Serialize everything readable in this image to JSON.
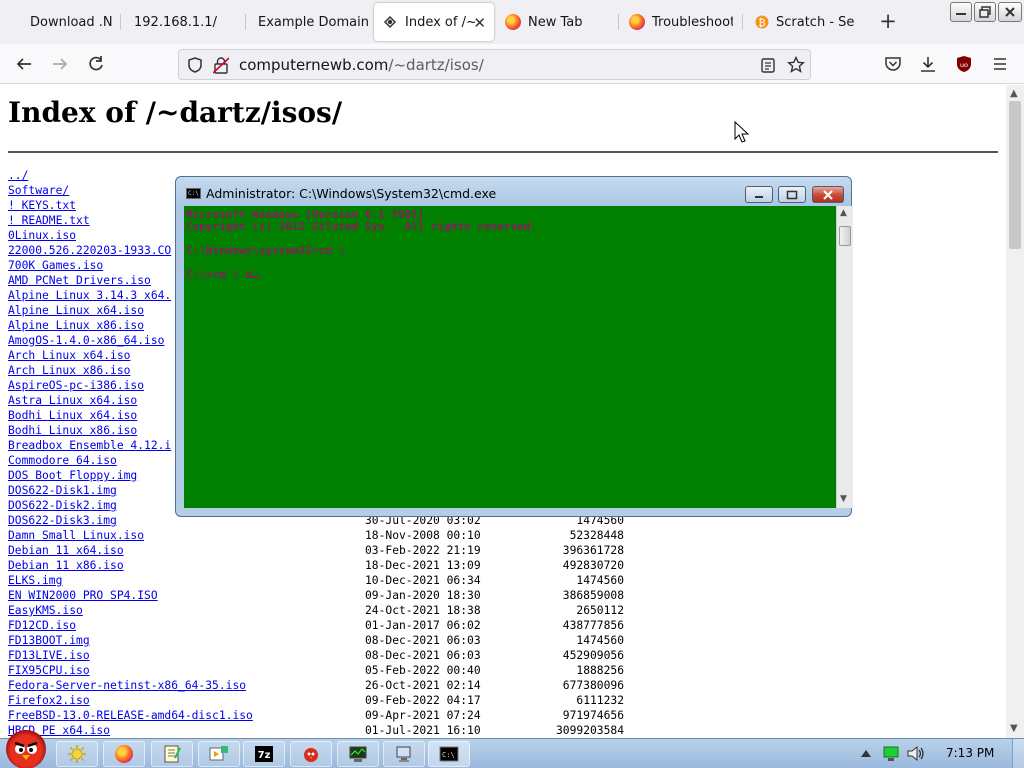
{
  "browser": {
    "tabs": [
      {
        "title": "Download .NE",
        "icon": "dotnet-icon",
        "active": false
      },
      {
        "title": "192.168.1.1/",
        "icon": "none",
        "active": false
      },
      {
        "title": "Example Domain",
        "icon": "none",
        "active": false
      },
      {
        "title": "Index of /~",
        "icon": "server-icon",
        "active": true
      },
      {
        "title": "New Tab",
        "icon": "firefox-icon",
        "active": false
      },
      {
        "title": "Troubleshooti",
        "icon": "firefox-icon",
        "active": false
      },
      {
        "title": "Scratch - Sear",
        "icon": "bitcoin-icon",
        "active": false
      }
    ],
    "url": {
      "host": "computernewb.com",
      "path": "/~dartz/isos/"
    }
  },
  "page": {
    "title": "Index of /~dartz/isos/",
    "files": [
      {
        "name": "../",
        "date": "",
        "size": ""
      },
      {
        "name": "Software/",
        "date": "",
        "size": ""
      },
      {
        "name": "! KEYS.txt",
        "date": "",
        "size": ""
      },
      {
        "name": "! README.txt",
        "date": "",
        "size": ""
      },
      {
        "name": "0Linux.iso",
        "date": "",
        "size": ""
      },
      {
        "name": "22000.526.220203-1933.CO",
        "date": "",
        "size": ""
      },
      {
        "name": "700K Games.iso",
        "date": "",
        "size": ""
      },
      {
        "name": "AMD PCNet Drivers.iso",
        "date": "",
        "size": ""
      },
      {
        "name": "Alpine Linux 3.14.3 x64.",
        "date": "",
        "size": ""
      },
      {
        "name": "Alpine Linux x64.iso",
        "date": "",
        "size": ""
      },
      {
        "name": "Alpine Linux x86.iso",
        "date": "",
        "size": ""
      },
      {
        "name": "AmogOS-1.4.0-x86_64.iso",
        "date": "",
        "size": ""
      },
      {
        "name": "Arch Linux x64.iso",
        "date": "",
        "size": ""
      },
      {
        "name": "Arch Linux x86.iso",
        "date": "",
        "size": ""
      },
      {
        "name": "AspireOS-pc-i386.iso",
        "date": "",
        "size": ""
      },
      {
        "name": "Astra Linux x64.iso",
        "date": "",
        "size": ""
      },
      {
        "name": "Bodhi Linux x64.iso",
        "date": "",
        "size": ""
      },
      {
        "name": "Bodhi Linux x86.iso",
        "date": "",
        "size": ""
      },
      {
        "name": "Breadbox Ensemble 4.12.i",
        "date": "",
        "size": ""
      },
      {
        "name": "Commodore 64.iso",
        "date": "",
        "size": ""
      },
      {
        "name": "DOS Boot Floppy.img",
        "date": "",
        "size": ""
      },
      {
        "name": "DOS622-Disk1.img",
        "date": "",
        "size": ""
      },
      {
        "name": "DOS622-Disk2.img",
        "date": "",
        "size": ""
      },
      {
        "name": "DOS622-Disk3.img",
        "date": "30-Jul-2020 03:02",
        "size": "1474560"
      },
      {
        "name": "Damn Small Linux.iso",
        "date": "18-Nov-2008 00:10",
        "size": "52328448"
      },
      {
        "name": "Debian 11 x64.iso",
        "date": "03-Feb-2022 21:19",
        "size": "396361728"
      },
      {
        "name": "Debian 11 x86.iso",
        "date": "18-Dec-2021 13:09",
        "size": "492830720"
      },
      {
        "name": "ELKS.img",
        "date": "10-Dec-2021 06:34",
        "size": "1474560"
      },
      {
        "name": "EN WIN2000 PRO SP4.ISO",
        "date": "09-Jan-2020 18:30",
        "size": "386859008"
      },
      {
        "name": "EasyKMS.iso",
        "date": "24-Oct-2021 18:38",
        "size": "2650112"
      },
      {
        "name": "FD12CD.iso",
        "date": "01-Jan-2017 06:02",
        "size": "438777856"
      },
      {
        "name": "FD13BOOT.img",
        "date": "08-Dec-2021 06:03",
        "size": "1474560"
      },
      {
        "name": "FD13LIVE.iso",
        "date": "08-Dec-2021 06:03",
        "size": "452909056"
      },
      {
        "name": "FIX95CPU.iso",
        "date": "05-Feb-2022 00:40",
        "size": "1888256"
      },
      {
        "name": "Fedora-Server-netinst-x86_64-35.iso",
        "date": "26-Oct-2021 02:14",
        "size": "677380096"
      },
      {
        "name": "Firefox2.iso",
        "date": "09-Feb-2022 04:17",
        "size": "6111232"
      },
      {
        "name": "FreeBSD-13.0-RELEASE-amd64-disc1.iso",
        "date": "09-Apr-2021 07:24",
        "size": "971974656"
      },
      {
        "name": "HBCD PE x64.iso",
        "date": "01-Jul-2021 16:10",
        "size": "3099203584"
      }
    ]
  },
  "cmd": {
    "title": "Administrator: C:\\Windows\\System32\\cmd.exe",
    "lines": [
      "Microsoft Windows [Version 6.1.7601]",
      "Copyright (c) 2012 Gilsted Sys.  All rights reserved.",
      "",
      "C:\\Windows\\system32>cd \\",
      "",
      "C:\\>cd \\ d"
    ],
    "background_color": "#008000",
    "text_color": "#8b1a5e"
  },
  "taskbar": {
    "clock": "7:13 PM"
  }
}
